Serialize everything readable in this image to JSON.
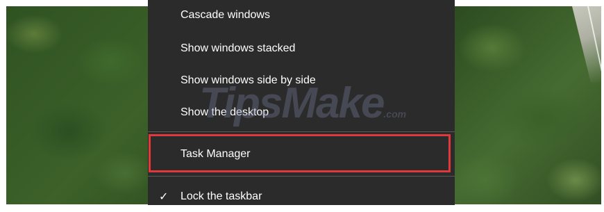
{
  "context_menu": {
    "items": [
      {
        "label": "Cascade windows",
        "checked": false
      },
      {
        "label": "Show windows stacked",
        "checked": false
      },
      {
        "label": "Show windows side by side",
        "checked": false
      },
      {
        "label": "Show the desktop",
        "checked": false
      },
      {
        "label": "Task Manager",
        "checked": false,
        "highlighted": true
      },
      {
        "label": "Lock the taskbar",
        "checked": true
      }
    ],
    "check_glyph": "✓"
  },
  "watermark": {
    "brand": "TipsMake",
    "suffix": ".com"
  },
  "colors": {
    "menu_background": "#2b2b2b",
    "menu_text": "#ffffff",
    "highlight_border": "#e0383b"
  }
}
